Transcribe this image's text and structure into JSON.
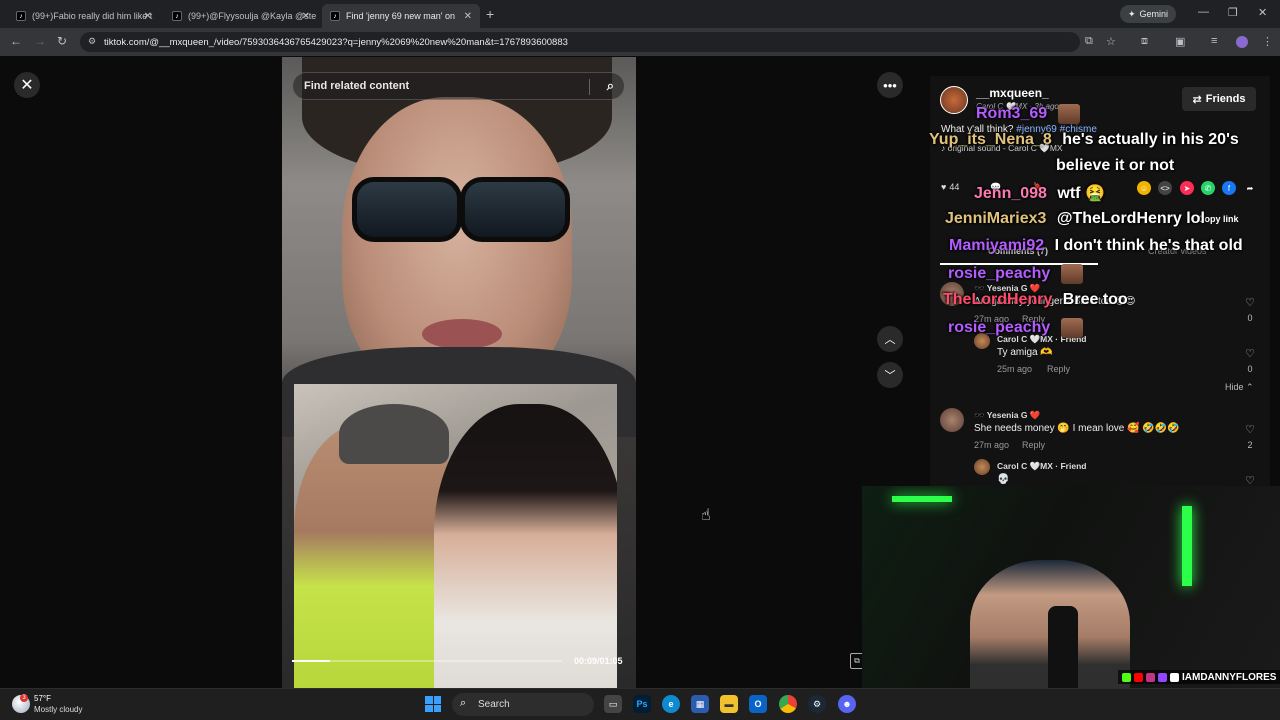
{
  "browser": {
    "tabs": [
      {
        "title": "(99+)Fabio really did him like t",
        "active": false
      },
      {
        "title": "(99+)@Flyysoulja @Kayla @ste",
        "active": false
      },
      {
        "title": "Find 'jenny 69 new man' on",
        "active": true
      }
    ],
    "new_tab": "+",
    "gemini_label": "Gemini",
    "url": "tiktok.com/@__mxqueen_/video/7593036436765429023?q=jenny%2069%20new%20man&t=1767893600883"
  },
  "viewer": {
    "search_placeholder": "Find related content",
    "time": "00:09/01:05",
    "progress_fraction": 0.14
  },
  "post": {
    "author": "__mxqueen_",
    "author_sub": "Carol C 🤍MX · 3h ago",
    "friends_label": "Friends",
    "caption_text": "What y'all think?",
    "caption_tags": "#jenny69 #chisme",
    "sound": "♪ original sound - Carol C 🤍MX",
    "likes": "44",
    "copy_link": "Copy link",
    "comments_tab": "Comments (7)",
    "creator_tab": "Creator videos"
  },
  "comments": [
    {
      "name": "🕶️ Yesenia G ❤️",
      "text": "Amiga they younger 2 Bree too 😍😍",
      "time": "27m ago",
      "reply": "Reply",
      "likes": "0"
    },
    {
      "name": "Carol C 🤍MX · Friend",
      "text": "Ty amiga 🫶",
      "time": "25m ago",
      "reply": "Reply",
      "likes": "0"
    },
    {
      "name": "🕶️ Yesenia G ❤️",
      "text": "She needs money 🤭 I mean love 🥰 🤣🤣🤣",
      "time": "27m ago",
      "reply": "Reply",
      "likes": "2"
    },
    {
      "name": "Carol C 🤍MX · Friend",
      "text": "💀",
      "time": "",
      "reply": "",
      "likes": ""
    }
  ],
  "hide_label": "Hide ⌃",
  "stream_chat": [
    {
      "user": "Rom3_69",
      "color": "#b45cff",
      "msg": ""
    },
    {
      "user": "Yup_its_Nena_8",
      "color": "#e0c27a",
      "msg": "he's actually in his 20's"
    },
    {
      "user": "",
      "color": "#ffffff",
      "msg": "believe it or not"
    },
    {
      "user": "Jenn_098",
      "color": "#ff7ab5",
      "msg": "wtf 🤮"
    },
    {
      "user": "JenniMariex3",
      "color": "#e0c27a",
      "msg": "@TheLordHenry lol"
    },
    {
      "user": "Mamiyami92",
      "color": "#b45cff",
      "msg": "I don't think he's that old"
    },
    {
      "user": "rosie_peachy",
      "color": "#b45cff",
      "msg": ""
    },
    {
      "user": "TheLordHenry",
      "color": "#ff4a6a",
      "msg": "Bree too"
    },
    {
      "user": "rosie_peachy",
      "color": "#b45cff",
      "msg": ""
    }
  ],
  "webcam": {
    "handle": "IAMDANNYFLORES",
    "social_colors": [
      "#53fc18",
      "#ff0000",
      "#c13584",
      "#9146ff",
      "#ffffff"
    ]
  },
  "taskbar": {
    "temp": "57°F",
    "weather": "Mostly cloudy",
    "weather_badge": "3",
    "search_label": "Search",
    "apps": [
      "Ps",
      "Edge",
      "Store",
      "Files",
      "Outlook",
      "Chrome",
      "Steam",
      "Discord"
    ]
  },
  "colors": {
    "accent": "#fe2c55",
    "link": "#8ab4ff"
  }
}
